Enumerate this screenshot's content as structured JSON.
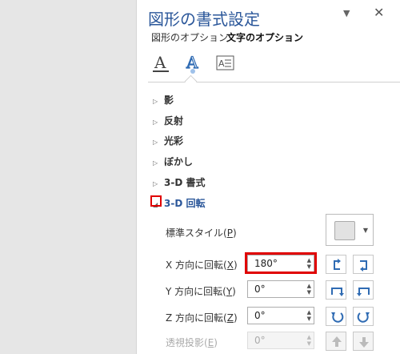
{
  "pane": {
    "title": "図形の書式設定",
    "tabs": [
      "図形のオプション",
      "文字のオプション"
    ],
    "icon_tabs": [
      "text-fill-outline-icon",
      "text-effects-icon",
      "textbox-icon"
    ]
  },
  "sections": [
    {
      "label": "影",
      "expanded": false
    },
    {
      "label": "反射",
      "expanded": false
    },
    {
      "label": "光彩",
      "expanded": false
    },
    {
      "label": "ぼかし",
      "expanded": false
    },
    {
      "label": "3-D 書式",
      "expanded": false
    },
    {
      "label": "3-D 回転",
      "expanded": true
    }
  ],
  "rotation": {
    "presets_label": "標準スタイル(",
    "presets_key": "P",
    "presets_tail": ")",
    "x": {
      "label": "X 方向に回転(",
      "key": "X",
      "tail": ")",
      "value": "180°"
    },
    "y": {
      "label": "Y 方向に回転(",
      "key": "Y",
      "tail": ")",
      "value": "0°"
    },
    "z": {
      "label": "Z 方向に回転(",
      "key": "Z",
      "tail": ")",
      "value": "0°"
    },
    "perspective": {
      "label": "透視投影(",
      "key": "E",
      "tail": ")",
      "value": "0°"
    }
  },
  "colors": {
    "accent": "#2b579a",
    "highlight": "#e00000",
    "button_icon": "#2f6bb3"
  }
}
